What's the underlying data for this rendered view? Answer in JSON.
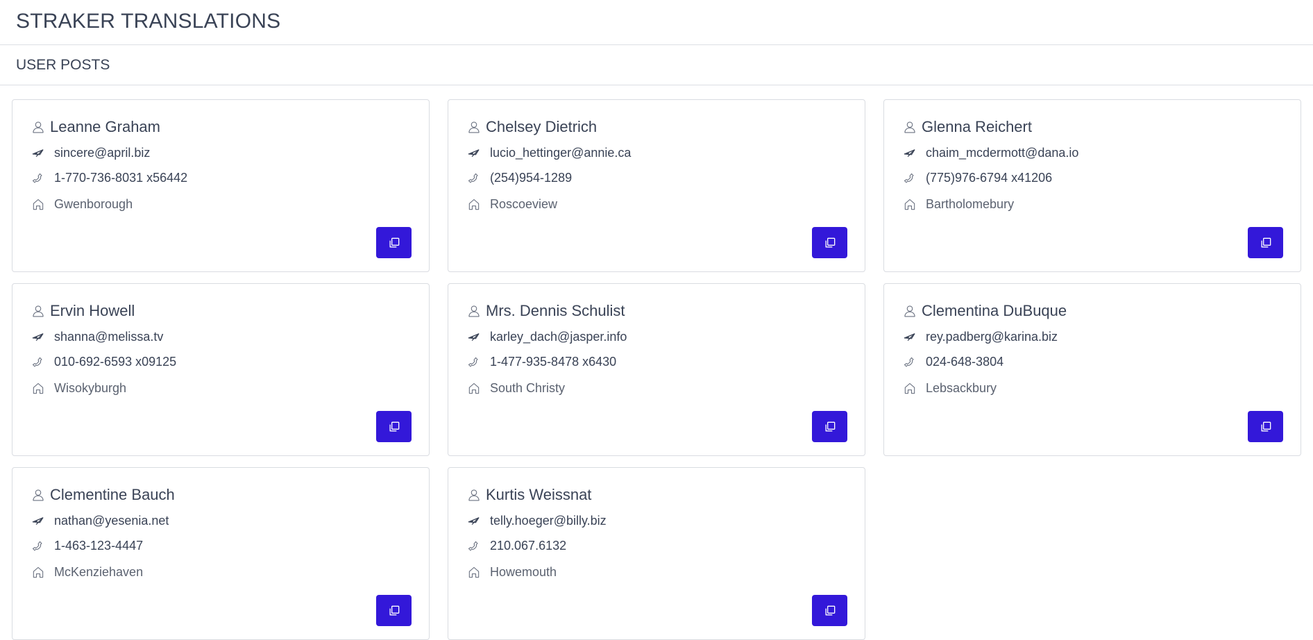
{
  "app": {
    "title": "STRAKER TRANSLATIONS"
  },
  "section": {
    "title": "USER POSTS"
  },
  "colors": {
    "accent": "#3318d9",
    "text": "#3a4356",
    "border": "#d9dce1"
  },
  "icons": {
    "name": "user-icon",
    "email": "send-icon",
    "phone": "phone-icon",
    "city": "home-icon",
    "action": "copy-icon"
  },
  "users": [
    {
      "name": "Leanne Graham",
      "email": "sincere@april.biz",
      "phone": "1-770-736-8031 x56442",
      "city": "Gwenborough"
    },
    {
      "name": "Chelsey Dietrich",
      "email": "lucio_hettinger@annie.ca",
      "phone": "(254)954-1289",
      "city": "Roscoeview"
    },
    {
      "name": "Glenna Reichert",
      "email": "chaim_mcdermott@dana.io",
      "phone": "(775)976-6794 x41206",
      "city": "Bartholomebury"
    },
    {
      "name": "Ervin Howell",
      "email": "shanna@melissa.tv",
      "phone": "010-692-6593 x09125",
      "city": "Wisokyburgh"
    },
    {
      "name": "Mrs. Dennis Schulist",
      "email": "karley_dach@jasper.info",
      "phone": "1-477-935-8478 x6430",
      "city": "South Christy"
    },
    {
      "name": "Clementina DuBuque",
      "email": "rey.padberg@karina.biz",
      "phone": "024-648-3804",
      "city": "Lebsackbury"
    },
    {
      "name": "Clementine Bauch",
      "email": "nathan@yesenia.net",
      "phone": "1-463-123-4447",
      "city": "McKenziehaven"
    },
    {
      "name": "Kurtis Weissnat",
      "email": "telly.hoeger@billy.biz",
      "phone": "210.067.6132",
      "city": "Howemouth"
    }
  ]
}
